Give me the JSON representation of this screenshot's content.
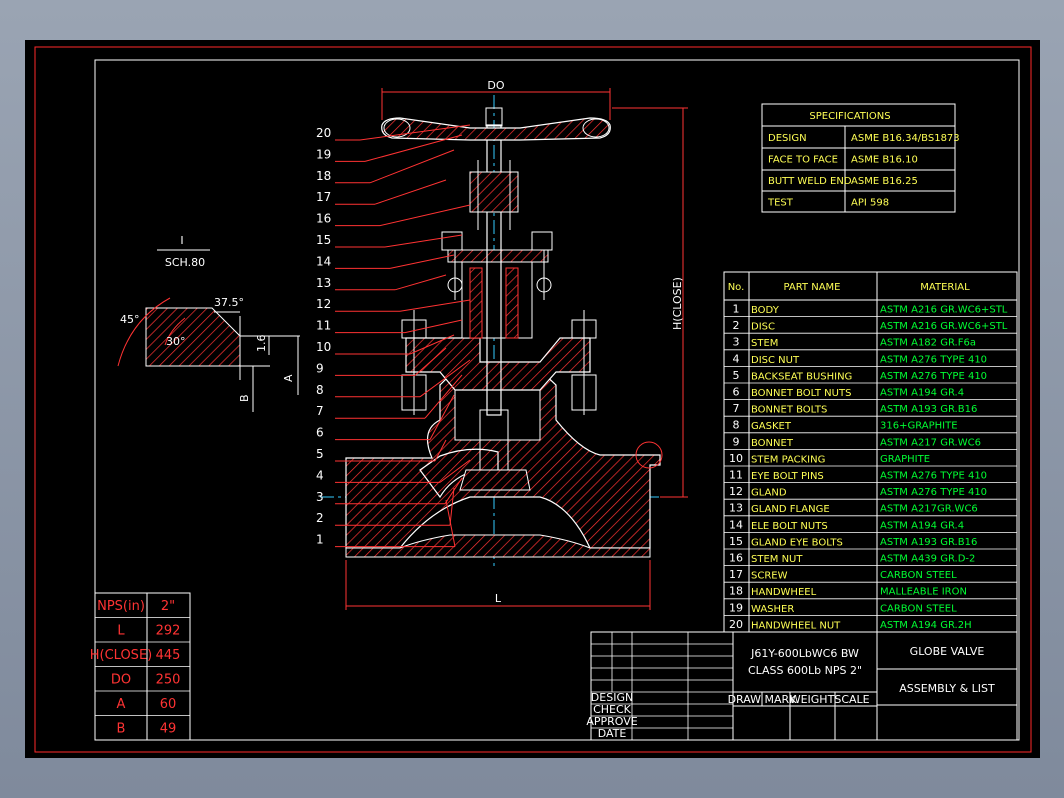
{
  "drawing": {
    "colors": {
      "background": "#000000",
      "frame": "#ff2a2a",
      "border": "#ffffff",
      "text": "#ffffff",
      "table": "#ff3333",
      "green": "#00ff33",
      "yellow": "#ffff55",
      "hatch": "#ff3333",
      "cyan": "#33ccff"
    },
    "pipe_spec": {
      "top": "I",
      "schedule": "SCH.80"
    },
    "bevel": {
      "angle_outer": "45°",
      "angle_inner": "30°",
      "angle_top": "37.5°",
      "dim_small": "1.6",
      "dim_a": "A",
      "dim_b": "B"
    },
    "dims": {
      "do": "DO",
      "l": "L",
      "h": "H(CLOSE)"
    },
    "leaders": [
      "20",
      "19",
      "18",
      "17",
      "16",
      "15",
      "14",
      "13",
      "12",
      "11",
      "10",
      "9",
      "8",
      "7",
      "6",
      "5",
      "4",
      "3",
      "2",
      "1"
    ],
    "specifications": {
      "title": "SPECIFICATIONS",
      "rows": [
        {
          "key": "DESIGN",
          "value": "ASME B16.34/BS1873"
        },
        {
          "key": "FACE TO FACE",
          "value": "ASME B16.10"
        },
        {
          "key": "BUTT WELD END",
          "value": "ASME B16.25"
        },
        {
          "key": "TEST",
          "value": "API 598"
        }
      ]
    },
    "parts": {
      "headers": [
        "No.",
        "PART NAME",
        "MATERIAL"
      ],
      "rows": [
        {
          "no": "1",
          "name": "BODY",
          "material": "ASTM A216 GR.WC6+STL"
        },
        {
          "no": "2",
          "name": "DISC",
          "material": "ASTM A216 GR.WC6+STL"
        },
        {
          "no": "3",
          "name": "STEM",
          "material": "ASTM A182 GR.F6a"
        },
        {
          "no": "4",
          "name": "DISC NUT",
          "material": "ASTM A276 TYPE 410"
        },
        {
          "no": "5",
          "name": "BACKSEAT BUSHING",
          "material": "ASTM A276 TYPE 410"
        },
        {
          "no": "6",
          "name": "BONNET BOLT NUTS",
          "material": "ASTM A194 GR.4"
        },
        {
          "no": "7",
          "name": "BONNET BOLTS",
          "material": "ASTM A193 GR.B16"
        },
        {
          "no": "8",
          "name": "GASKET",
          "material": "316+GRAPHITE"
        },
        {
          "no": "9",
          "name": "BONNET",
          "material": "ASTM A217 GR.WC6"
        },
        {
          "no": "10",
          "name": "STEM PACKING",
          "material": "GRAPHITE"
        },
        {
          "no": "11",
          "name": "EYE BOLT PINS",
          "material": "ASTM A276 TYPE 410"
        },
        {
          "no": "12",
          "name": "GLAND",
          "material": "ASTM A276 TYPE 410"
        },
        {
          "no": "13",
          "name": "GLAND FLANGE",
          "material": "ASTM A217GR.WC6"
        },
        {
          "no": "14",
          "name": "ELE BOLT NUTS",
          "material": "ASTM A194 GR.4"
        },
        {
          "no": "15",
          "name": "GLAND EYE BOLTS",
          "material": "ASTM A193 GR.B16"
        },
        {
          "no": "16",
          "name": "STEM NUT",
          "material": "ASTM A439 GR.D-2"
        },
        {
          "no": "17",
          "name": "SCREW",
          "material": "CARBON STEEL"
        },
        {
          "no": "18",
          "name": "HANDWHEEL",
          "material": "MALLEABLE IRON"
        },
        {
          "no": "19",
          "name": "WASHER",
          "material": "CARBON STEEL"
        },
        {
          "no": "20",
          "name": "HANDWHEEL NUT",
          "material": "ASTM A194 GR.2H"
        }
      ]
    },
    "dimensions_table": {
      "rows": [
        {
          "label": "NPS(in)",
          "value": "2\""
        },
        {
          "label": "L",
          "value": "292"
        },
        {
          "label": "H(CLOSE)",
          "value": "445"
        },
        {
          "label": "DO",
          "value": "250"
        },
        {
          "label": "A",
          "value": "60"
        },
        {
          "label": "B",
          "value": "49"
        }
      ]
    },
    "title_block": {
      "model_line1": "J61Y-600LbWC6 BW",
      "model_line2": "CLASS 600Lb NPS 2\"",
      "title": "GLOBE VALVE",
      "subtitle": "ASSEMBLY & LIST",
      "signoff": [
        "DESIGN",
        "CHECK",
        "APPROVE",
        "DATE"
      ],
      "columns": [
        "DRAW MARK",
        "WEIGHT",
        "SCALE"
      ]
    }
  }
}
